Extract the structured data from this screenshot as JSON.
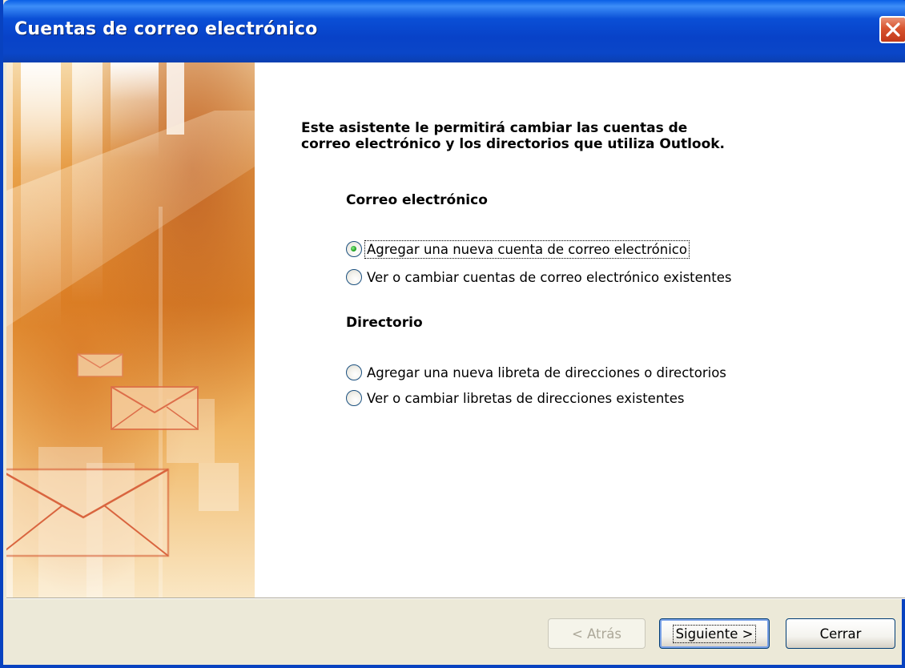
{
  "window": {
    "title": "Cuentas de correo electrónico",
    "close_icon": "close-icon"
  },
  "intro": {
    "line1": "Este asistente le permitirá cambiar las cuentas de",
    "line2": "correo electrónico y los directorios que utiliza Outlook."
  },
  "email_section": {
    "heading": "Correo electrónico",
    "options": [
      {
        "label": "Agregar una nueva cuenta de correo electrónico",
        "selected": true
      },
      {
        "label": "Ver o cambiar cuentas de correo electrónico existentes",
        "selected": false
      }
    ]
  },
  "directory_section": {
    "heading": "Directorio",
    "options": [
      {
        "label": "Agregar una nueva libreta de direcciones o directorios",
        "selected": false
      },
      {
        "label": "Ver o cambiar libretas de direcciones existentes",
        "selected": false
      }
    ]
  },
  "buttons": {
    "back": "< Atrás",
    "next": "Siguiente >",
    "close": "Cerrar"
  },
  "colors": {
    "titlebar": "#0A4FD6",
    "dialog_bg": "#ECE9D8",
    "art_orange": "#E8962E",
    "radio_selected": "#21A121"
  }
}
